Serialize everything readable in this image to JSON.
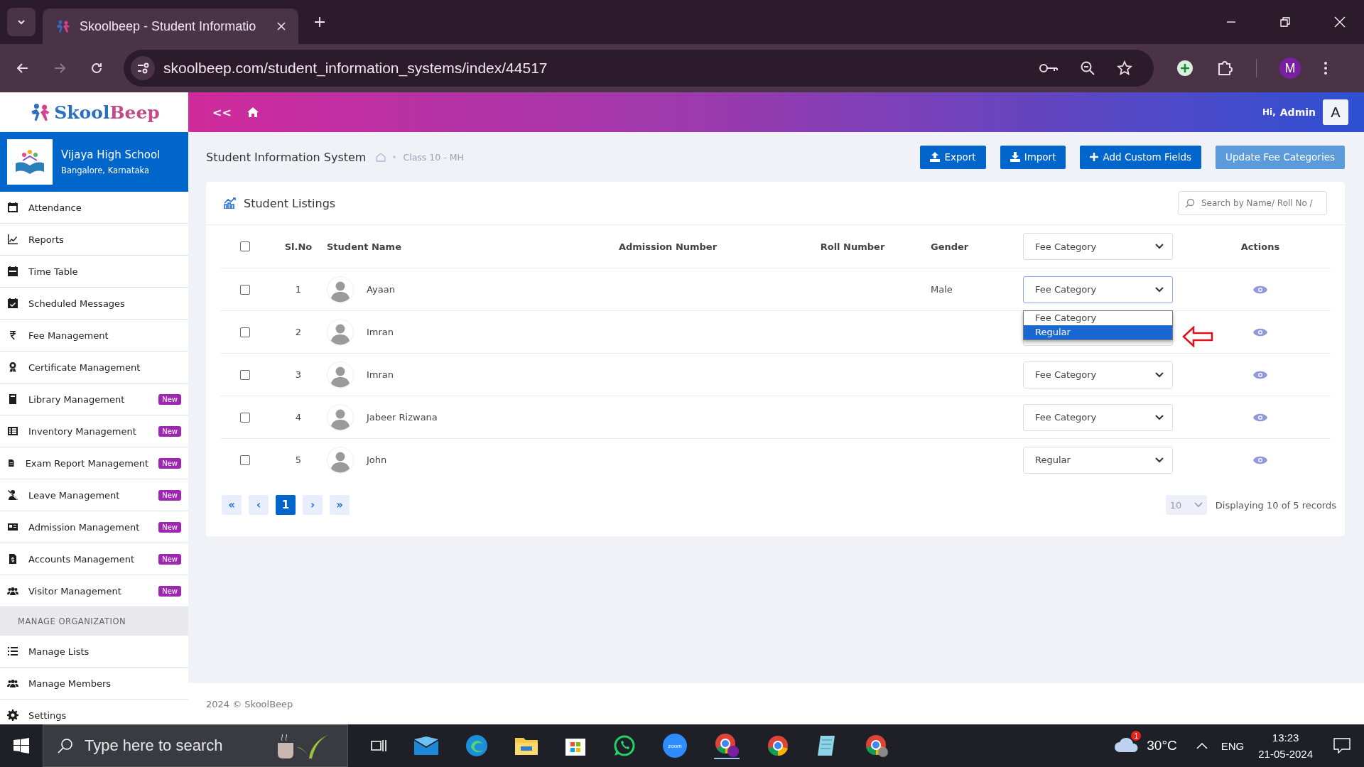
{
  "browser": {
    "tab_title": "Skoolbeep - Student Informatio",
    "url": "skoolbeep.com/student_information_systems/index/44517",
    "profile": "M"
  },
  "header": {
    "logo": {
      "first": "Skool",
      "second": "Beep"
    },
    "collapse": "<<",
    "greeting": "Hi,",
    "user": "Admin",
    "avatar": "A"
  },
  "sidebar": {
    "school": {
      "name": "Vijaya High School",
      "location": "Bangalore, Karnataka"
    },
    "items": [
      {
        "label": "Attendance"
      },
      {
        "label": "Reports"
      },
      {
        "label": "Time Table"
      },
      {
        "label": "Scheduled Messages"
      },
      {
        "label": "Fee Management"
      },
      {
        "label": "Certificate Management"
      },
      {
        "label": "Library Management",
        "badge": "New"
      },
      {
        "label": "Inventory Management",
        "badge": "New"
      },
      {
        "label": "Exam Report Management",
        "badge": "New"
      },
      {
        "label": "Leave Management",
        "badge": "New"
      },
      {
        "label": "Admission Management",
        "badge": "New"
      },
      {
        "label": "Accounts Management",
        "badge": "New"
      },
      {
        "label": "Visitor Management",
        "badge": "New"
      }
    ],
    "section": {
      "title": "MANAGE ORGANIZATION",
      "items": [
        {
          "label": "Manage Lists"
        },
        {
          "label": "Manage Members"
        },
        {
          "label": "Settings"
        }
      ]
    }
  },
  "page": {
    "title": "Student Information System",
    "breadcrumb": "Class 10 - MH",
    "buttons": [
      {
        "label": "Export",
        "kind": "export"
      },
      {
        "label": "Import",
        "kind": "import"
      },
      {
        "label": "Add Custom Fields",
        "kind": "add"
      },
      {
        "label": "Update Fee Categories",
        "kind": "plain"
      }
    ]
  },
  "listing": {
    "title": "Student Listings",
    "search": {
      "placeholder": "Search by Name/ Roll No /"
    },
    "columns": [
      "Sl.No",
      "Student Name",
      "Admission Number",
      "Roll Number",
      "Gender",
      "Fee Category",
      "Actions"
    ],
    "header_checked": false,
    "rows": [
      {
        "sl": "1",
        "name": "Ayaan",
        "gender": "Male",
        "checked": false,
        "fee": {
          "value": "Fee Category",
          "open": true,
          "options": [
            {
              "label": "Fee Category",
              "highlighted": false
            },
            {
              "label": "Regular",
              "highlighted": true
            }
          ]
        }
      },
      {
        "sl": "2",
        "name": "Imran",
        "checked": false,
        "fee": {
          "open": false
        }
      },
      {
        "sl": "3",
        "name": "Imran",
        "checked": false,
        "fee": {
          "value": "Fee Category",
          "open": false
        }
      },
      {
        "sl": "4",
        "name": "Jabeer Rizwana",
        "checked": false,
        "fee": {
          "value": "Fee Category",
          "open": false
        }
      },
      {
        "sl": "5",
        "name": "John",
        "checked": false,
        "fee": {
          "value": "Regular",
          "open": false
        }
      }
    ],
    "pagination": [
      {
        "label": "«",
        "selected": false
      },
      {
        "label": "‹",
        "selected": false
      },
      {
        "label": "1",
        "selected": true
      },
      {
        "label": "›",
        "selected": false
      },
      {
        "label": "»",
        "selected": false
      }
    ],
    "per_page": "10",
    "summary": "Displaying 10 of 5 records"
  },
  "footer": "2024 © SkoolBeep",
  "taskbar": {
    "search_placeholder": "Type here to search",
    "zoom_label": "zoom",
    "weather": {
      "badge": "1",
      "temp": "30°C"
    },
    "language": "ENG",
    "time": "13:23",
    "date": "21-05-2024"
  }
}
